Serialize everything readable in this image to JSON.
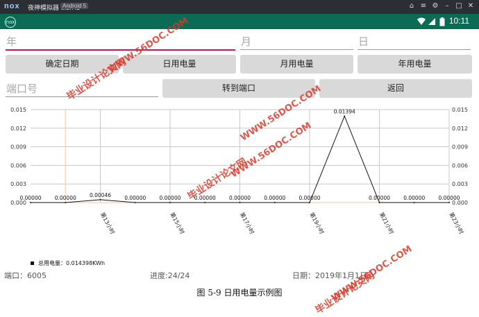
{
  "window": {
    "logo": "nox",
    "title": "夜神模拟器 6.2.7.1",
    "badge": "Android 5",
    "controls": [
      "⌂",
      "≡",
      "⚙",
      "–",
      "□",
      "✕"
    ]
  },
  "statusbar": {
    "app_icon": "nox",
    "time": "10:11"
  },
  "inputs": {
    "year": {
      "placeholder": "年"
    },
    "month": {
      "placeholder": "月"
    },
    "day": {
      "placeholder": "日"
    },
    "port": {
      "placeholder": "端口号"
    }
  },
  "buttons": {
    "confirm_date": "确定日期",
    "daily": "日用电量",
    "monthly": "月用电量",
    "yearly": "年用电量",
    "goto_port": "转到端口",
    "back": "返回"
  },
  "chart_data": {
    "type": "line",
    "y_ticks": [
      "0.000",
      "0.003",
      "0.006",
      "0.009",
      "0.012",
      "0.015"
    ],
    "ylim": [
      0,
      0.015
    ],
    "x_tick_labels": [
      "第13小时",
      "第15小时",
      "第17小时",
      "第19小时",
      "第21小时",
      "第23小时"
    ],
    "x_tick_positions": [
      13,
      15,
      17,
      19,
      21,
      23
    ],
    "xlim": [
      11,
      23
    ],
    "series": [
      {
        "name": "总用电量：0.014398KWh",
        "x": [
          11,
          12,
          13,
          14,
          15,
          16,
          17,
          18,
          19,
          20,
          21,
          22,
          23
        ],
        "y": [
          0.0,
          0.0,
          0.00046,
          0.0,
          0.0,
          0.0,
          0.0,
          0.0,
          0.0,
          0.01394,
          0.0,
          0.0,
          0.0
        ],
        "labels": [
          "0.00000",
          "0.00000",
          "0.00046",
          "0.00000",
          "0.00000",
          "0.00000",
          "0.00000",
          "0.00000",
          "0.00000",
          "0.01394",
          "0.00000",
          "0.00000",
          "0.00000"
        ]
      }
    ],
    "grid": true,
    "legend": "bottom-left",
    "colors": {
      "line": "#111111",
      "grid": "#c8c8c8",
      "highlight": "#f4c6a6"
    }
  },
  "info": {
    "port": "端口：6005",
    "progress": "进度:24/24",
    "date": "日期：2019年1月1日"
  },
  "caption": "图 5-9  日用电量示例图",
  "watermarks": [
    "毕业设计论文网",
    "WWW.56DOC.COM"
  ]
}
